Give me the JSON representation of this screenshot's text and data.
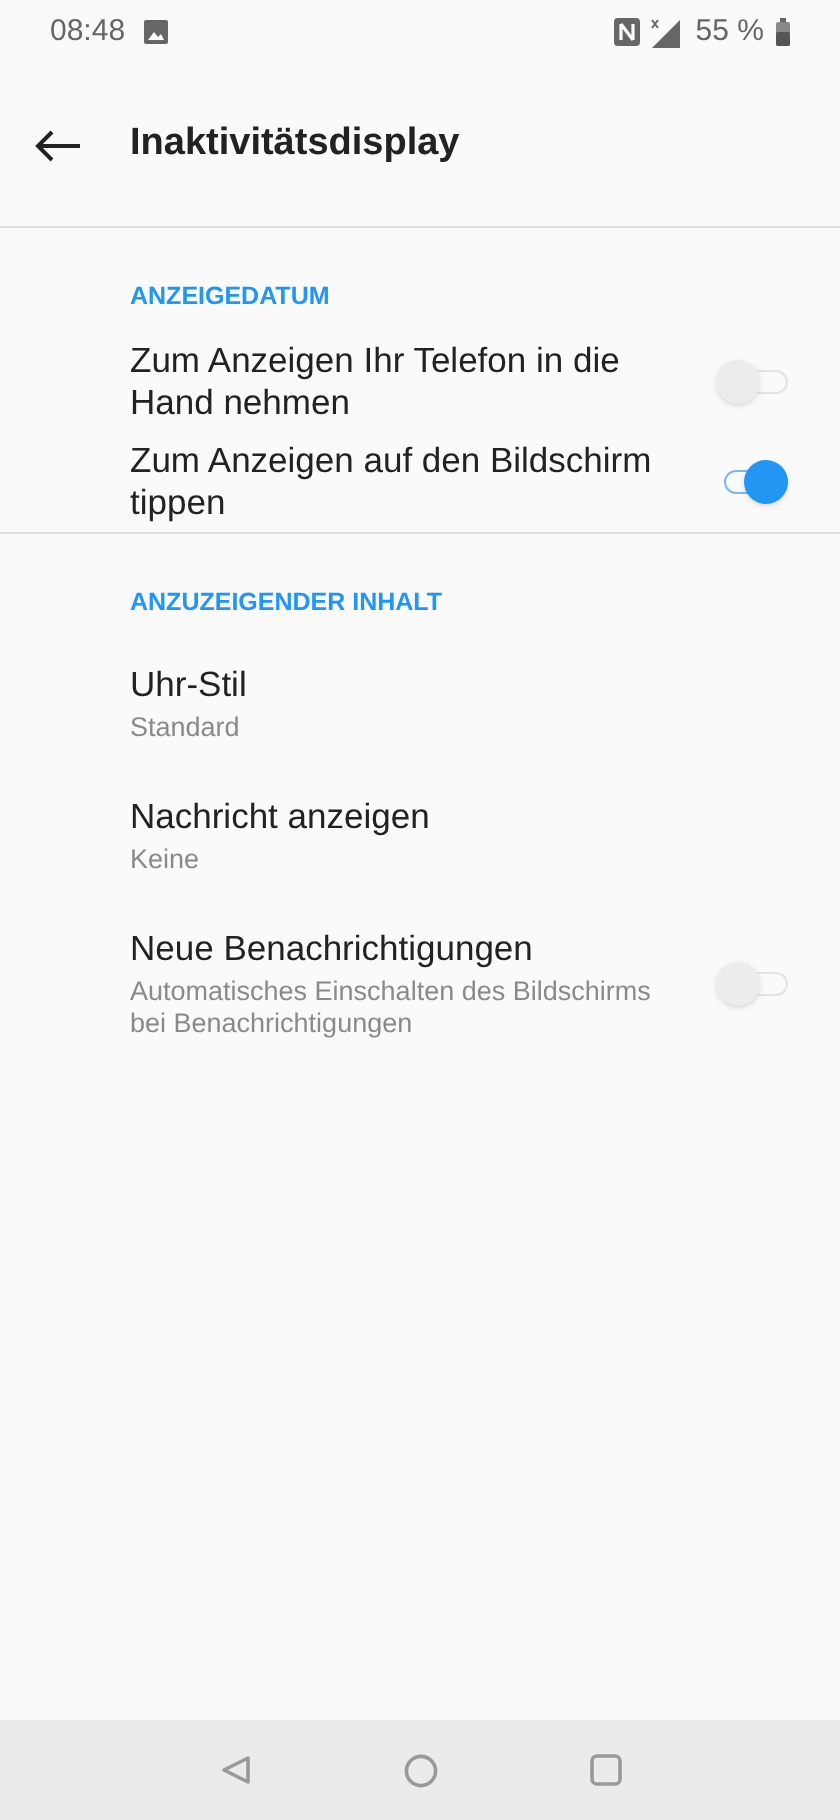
{
  "status_bar": {
    "time": "08:48",
    "battery": "55 %"
  },
  "header": {
    "title": "Inaktivitätsdisplay"
  },
  "sections": [
    {
      "title": "ANZEIGEDATUM",
      "items": [
        {
          "kind": "toggle",
          "title": "Zum Anzeigen Ihr Telefon in die Hand nehmen",
          "on": false
        },
        {
          "kind": "toggle",
          "title": "Zum Anzeigen auf den Bildschirm tippen",
          "on": true
        }
      ]
    },
    {
      "title": "ANZUZEIGENDER INHALT",
      "items": [
        {
          "kind": "plain",
          "title": "Uhr-Stil",
          "summary": "Standard"
        },
        {
          "kind": "plain",
          "title": "Nachricht anzeigen",
          "summary": "Keine"
        },
        {
          "kind": "toggle",
          "title": "Neue Benachrichtigungen",
          "summary": "Automatisches Einschalten des Bildschirms bei Benachrichtigungen",
          "on": false
        }
      ]
    }
  ]
}
